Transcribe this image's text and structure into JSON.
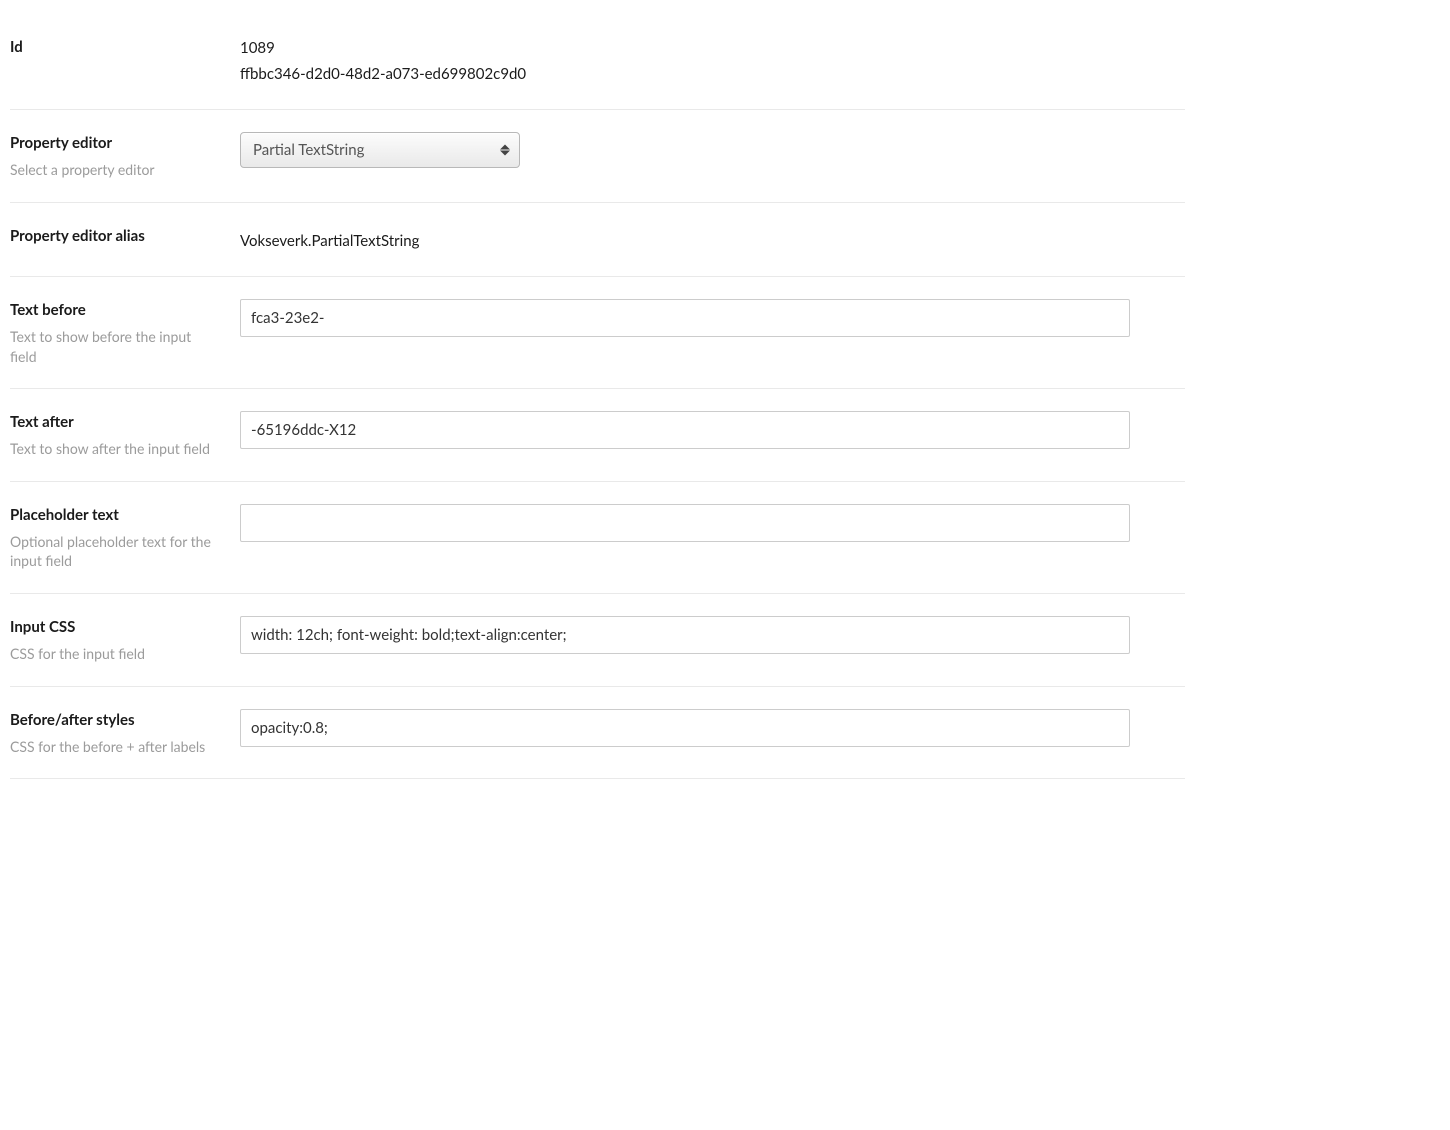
{
  "rows": {
    "id": {
      "label": "Id",
      "value_line1": "1089",
      "value_line2": "ffbbc346-d2d0-48d2-a073-ed699802c9d0"
    },
    "property_editor": {
      "label": "Property editor",
      "desc": "Select a property editor",
      "selected": "Partial TextString"
    },
    "property_editor_alias": {
      "label": "Property editor alias",
      "value": "Vokseverk.PartialTextString"
    },
    "text_before": {
      "label": "Text before",
      "desc": "Text to show before the input field",
      "value": "fca3-23e2-"
    },
    "text_after": {
      "label": "Text after",
      "desc": "Text to show after the input field",
      "value": "-65196ddc-X12"
    },
    "placeholder_text": {
      "label": "Placeholder text",
      "desc": "Optional placeholder text for the input field",
      "value": ""
    },
    "input_css": {
      "label": "Input CSS",
      "desc": "CSS for the input field",
      "value": "width: 12ch; font-weight: bold;text-align:center;"
    },
    "before_after_styles": {
      "label": "Before/after styles",
      "desc": "CSS for the before + after labels",
      "value": "opacity:0.8;"
    }
  }
}
